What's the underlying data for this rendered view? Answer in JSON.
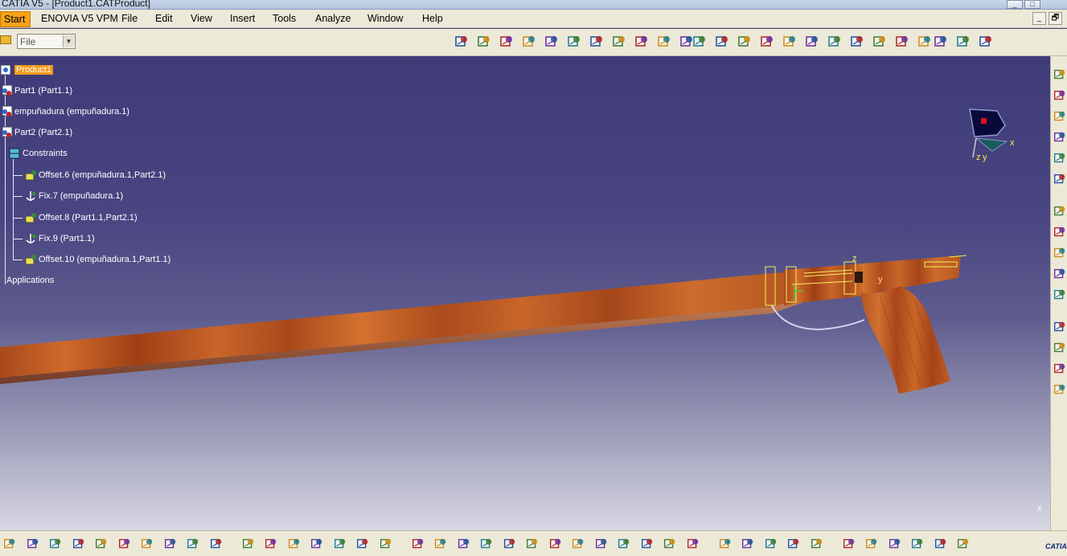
{
  "window": {
    "title": "CATIA V5 - [Product1.CATProduct]",
    "controls": [
      "_",
      "□"
    ],
    "mdi_controls": [
      "_",
      "🗗"
    ]
  },
  "menu": {
    "start": "Start",
    "items": [
      "ENOVIA V5 VPM",
      "File",
      "Edit",
      "View",
      "Insert",
      "Tools",
      "Analyze",
      "Window",
      "Help"
    ]
  },
  "toolbar": {
    "file_combo_value": "File",
    "top_icons": [
      "link-icon",
      "part-icon",
      "shading-icon",
      "fix-icon",
      "anchor-icon",
      "spring-icon",
      "snap-icon",
      "flexible-icon",
      "update-icon",
      "explode-icon",
      "assembly-feature-icon",
      "gear-icon",
      "gear-add-icon",
      "replace-icon",
      "component-icon",
      "scene-icon",
      "catalog-icon",
      "bill-icon",
      "table-icon",
      "annotate-icon",
      "properties-icon",
      "sketch-icon",
      "measure-icon",
      "clash-icon",
      "star-icon"
    ],
    "bottom_icons": [
      "new-icon",
      "open-icon",
      "save-icon",
      "print-icon",
      "cut-icon",
      "copy-icon",
      "paste-icon",
      "undo-icon",
      "redo-icon",
      "whats-this-icon",
      "formula-icon",
      "comment-icon",
      "tag-icon",
      "grid-icon",
      "network-icon",
      "lock-icon",
      "bracket-icon",
      "fly-icon",
      "fit-all-icon",
      "pan-icon",
      "rotate-icon",
      "zoom-in-icon",
      "zoom-out-icon",
      "normal-view-icon",
      "iso-view-icon",
      "cube-view-icon",
      "hide-show-icon",
      "swap-icon",
      "clipping-icon",
      "catalog-bottom-icon",
      "sim-icon",
      "gear-run-icon",
      "brush-icon",
      "settings-icon",
      "chain-icon",
      "arrows-icon",
      "copy-geom-icon",
      "paste-geom-icon",
      "camera-icon",
      "export-icon",
      "refresh-icon",
      "catia-logo-icon"
    ],
    "right_icons": [
      "drafting-icon",
      "doc-icon",
      "doc-icon",
      "edit-icon",
      "sketch-icon",
      "model-icon",
      "model-icon",
      "model-icon",
      "model-icon",
      "model-icon",
      "list-icon",
      "cube-icon",
      "sheet-icon",
      "sheet-icon",
      "sheet-icon"
    ]
  },
  "tree": {
    "root": "Product1",
    "items": [
      {
        "label": "Part1 (Part1.1)",
        "icon": "part-icon"
      },
      {
        "label": "empuñadura (empuñadura.1)",
        "icon": "part-icon"
      },
      {
        "label": "Part2 (Part2.1)",
        "icon": "part-icon"
      },
      {
        "label": "Constraints",
        "icon": "constraints-icon"
      }
    ],
    "constraints": [
      {
        "label": "Offset.6 (empuñadura.1,Part2.1)",
        "icon": "offset-icon"
      },
      {
        "label": "Fix.7 (empuñadura.1)",
        "icon": "fix-icon"
      },
      {
        "label": "Offset.8 (Part1.1,Part2.1)",
        "icon": "offset-icon"
      },
      {
        "label": "Fix.9 (Part1.1)",
        "icon": "fix-icon"
      },
      {
        "label": "Offset.10 (empuñadura.1,Part1.1)",
        "icon": "offset-icon"
      }
    ],
    "applications": "Applications"
  },
  "compass": {
    "x_label": "x",
    "y_label": "y",
    "z_label": "z"
  },
  "axis_labels": {
    "z": "z",
    "y": "y",
    "x": "x"
  },
  "logo": {
    "text": "CATIA"
  },
  "colors": {
    "wood": "#b5541a",
    "tree_highlight": "#f39a1a",
    "background_top": "#3f3b78"
  }
}
